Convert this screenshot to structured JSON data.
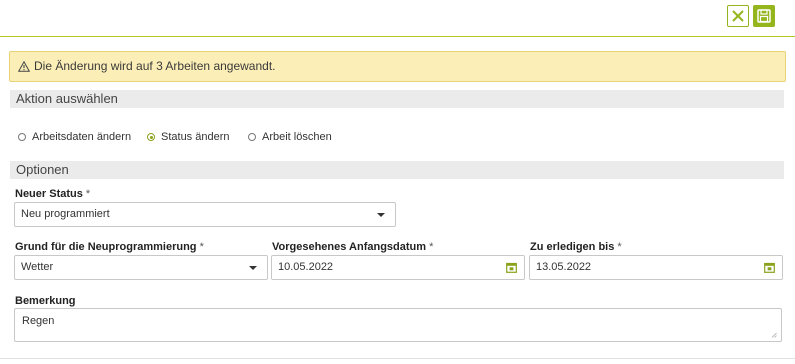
{
  "toolbar": {
    "close_icon": "close-icon",
    "save_icon": "save-icon"
  },
  "alert": {
    "icon": "warning-icon",
    "text": "Die Änderung wird auf 3 Arbeiten angewandt."
  },
  "sections": {
    "action_title": "Aktion auswählen",
    "options_title": "Optionen"
  },
  "actions": [
    {
      "label": "Arbeitsdaten ändern",
      "checked": false
    },
    {
      "label": "Status ändern",
      "checked": true
    },
    {
      "label": "Arbeit löschen",
      "checked": false
    }
  ],
  "form": {
    "status": {
      "label": "Neuer Status",
      "required": "*",
      "value": "Neu programmiert"
    },
    "reason": {
      "label": "Grund für die Neuprogrammierung",
      "required": "*",
      "value": "Wetter"
    },
    "start_date": {
      "label": "Vorgesehenes Anfangsdatum",
      "required": "*",
      "value": "10.05.2022"
    },
    "due_date": {
      "label": "Zu erledigen bis",
      "required": "*",
      "value": "13.05.2022"
    },
    "remark": {
      "label": "Bemerkung",
      "value": "Regen"
    }
  },
  "colors": {
    "accent": "#94b51c",
    "alert_bg": "#fbefb7",
    "section_bg": "#ebebeb"
  }
}
